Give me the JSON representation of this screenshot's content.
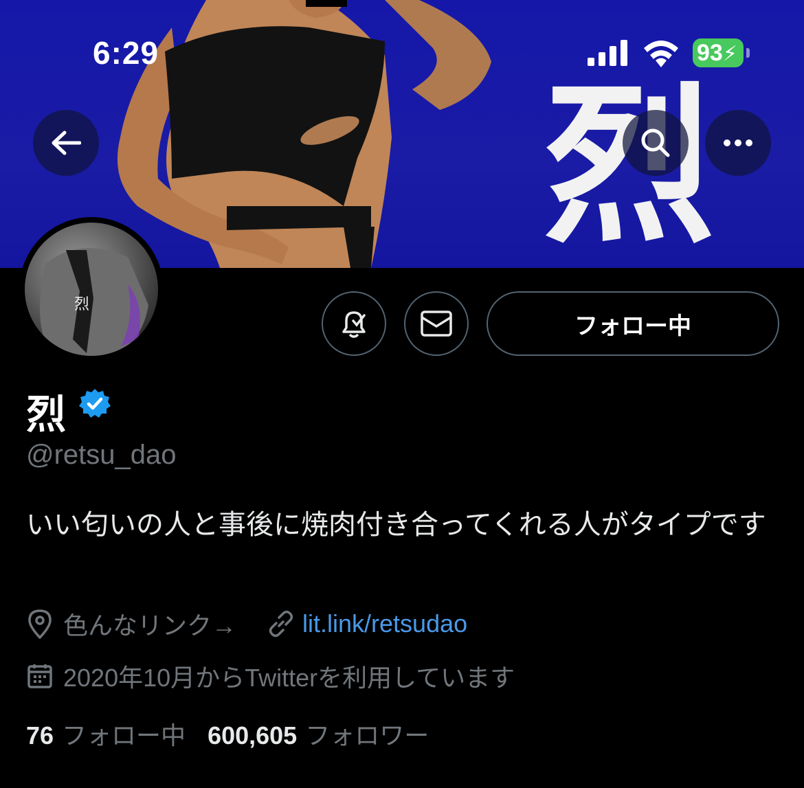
{
  "status_bar": {
    "time": "6:29",
    "battery": "93"
  },
  "banner": {
    "kanji": "烈"
  },
  "profile": {
    "display_name": "烈",
    "handle": "@retsu_dao",
    "bio": "いい匂いの人と事後に焼肉付き合ってくれる人がタイプです",
    "location": "色んなリンク→",
    "website": "lit.link/retsudao",
    "joined": "2020年10月からTwitterを利用しています",
    "following_count": "76",
    "following_label": "フォロー中",
    "followers_count": "600,605",
    "followers_label": "フォロワー"
  },
  "actions": {
    "follow_label": "フォロー中"
  },
  "colors": {
    "banner": "#1517a8",
    "verified": "#1d9bf0",
    "link": "#4a99e9",
    "battery": "#47c95d"
  }
}
